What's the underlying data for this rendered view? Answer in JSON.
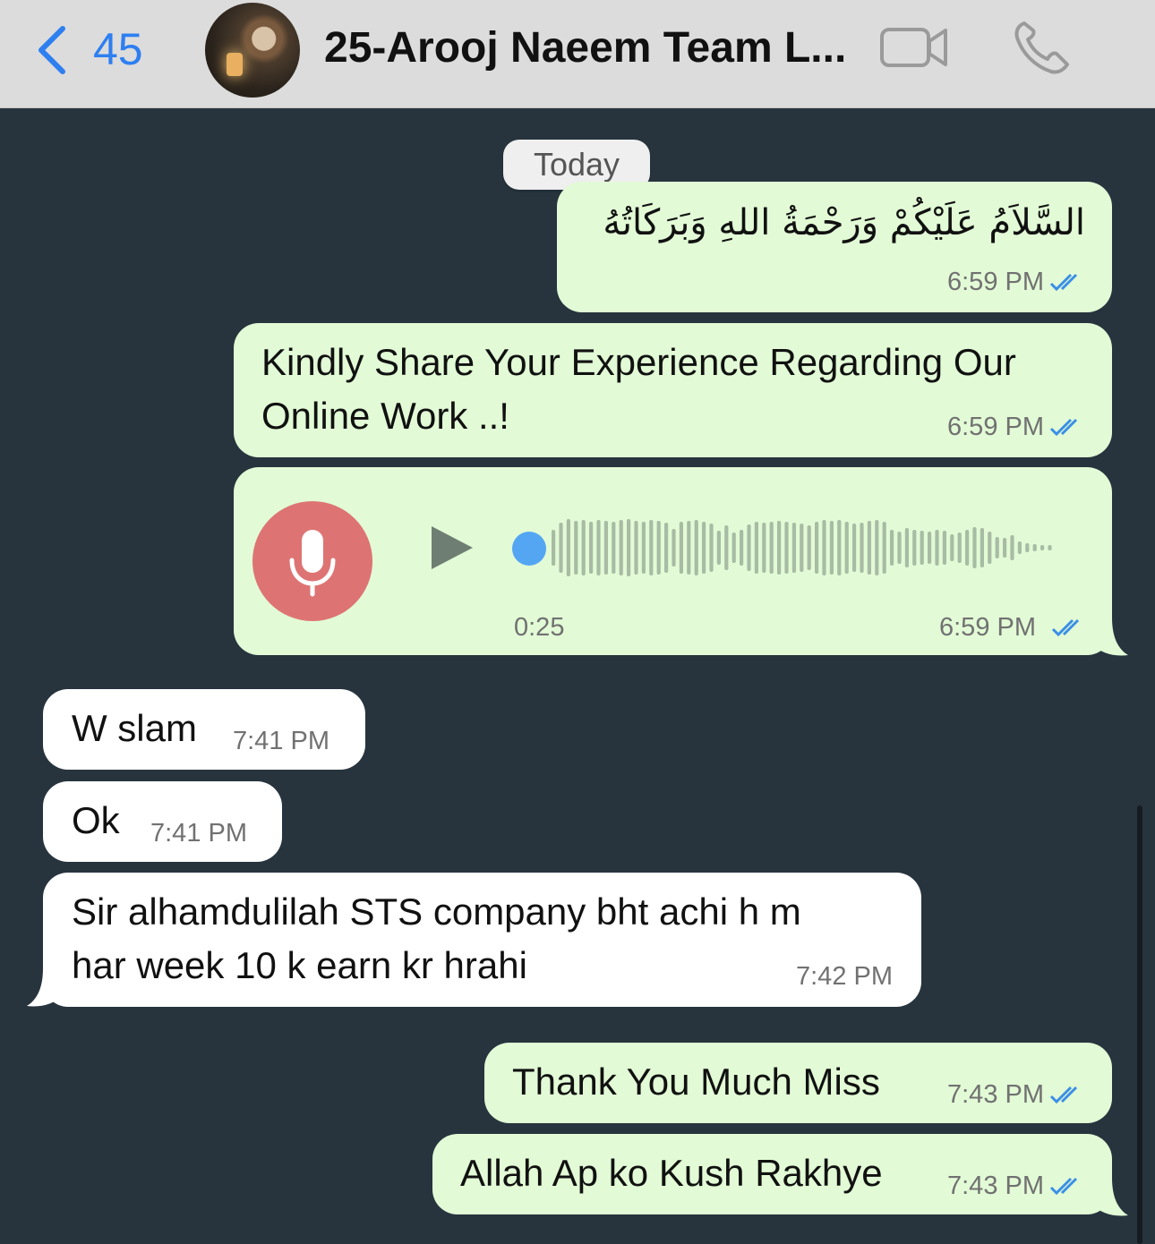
{
  "header": {
    "back_count": "45",
    "chat_title": "25-Arooj Naeem Team L..."
  },
  "date_chip": "Today",
  "messages": [
    {
      "text": "السَّلاَمُ عَلَيْكُمْ وَرَحْمَةُ اللهِ وَبَرَكَاتُهُ",
      "time": "6:59 PM"
    },
    {
      "line1": "Kindly Share Your Experience Regarding Our",
      "line2": "Online Work ..!",
      "time": "6:59 PM"
    },
    {
      "duration": "0:25",
      "time": "6:59 PM",
      "progress": 0.0
    },
    {
      "text": "W slam",
      "time": "7:41 PM"
    },
    {
      "text": "Ok",
      "time": "7:41 PM"
    },
    {
      "line1": "Sir alhamdulilah STS company bht achi h m",
      "line2": "har week 10 k earn kr hrahi",
      "time": "7:42 PM"
    },
    {
      "text": "Thank You Much Miss",
      "time": "7:43 PM"
    },
    {
      "text": "Allah Ap ko Kush Rakhye",
      "time": "7:43 PM"
    }
  ],
  "colors": {
    "background": "#27343e",
    "outgoing_bubble": "#e2fbd6",
    "incoming_bubble": "#ffffff",
    "accent_blue": "#2e7ff0",
    "read_ticks": "#3b8fe6",
    "mic_red": "#dd7473"
  },
  "icons": [
    "back-chevron-icon",
    "video-call-icon",
    "phone-call-icon",
    "microphone-icon",
    "play-icon",
    "double-check-icon"
  ]
}
